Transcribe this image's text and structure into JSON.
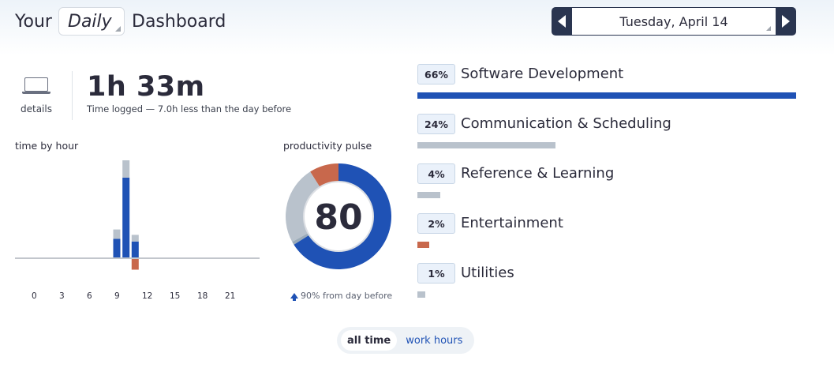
{
  "header": {
    "title_prefix": "Your",
    "period": "Daily",
    "title_suffix": "Dashboard",
    "date": "Tuesday, April 14"
  },
  "summary": {
    "details_label": "details",
    "time_total": "1h 33m",
    "time_note": "Time logged — 7.0h less than the day before"
  },
  "charts": {
    "time_by_hour_title": "time by hour",
    "productivity_title": "productivity pulse",
    "pulse_note": "90% from day before"
  },
  "chart_data": [
    {
      "type": "bar",
      "title": "time by hour",
      "x_ticks": [
        "0",
        "3",
        "6",
        "9",
        "12",
        "15",
        "18",
        "21"
      ],
      "hours": [
        9,
        10,
        11
      ],
      "series": [
        {
          "color": "#1f52b5",
          "values_minutes": [
            14,
            60,
            12
          ],
          "direction": "up"
        },
        {
          "color": "#b9c2cc",
          "values_minutes": [
            7,
            13,
            5
          ],
          "direction": "up"
        },
        {
          "color": "#c8684c",
          "values_minutes": [
            0,
            0,
            8
          ],
          "direction": "down"
        }
      ]
    },
    {
      "type": "pie",
      "title": "productivity pulse",
      "center_value": "80",
      "slices": [
        {
          "color": "#1f52b5",
          "value": 66
        },
        {
          "color": "#9aaab8",
          "value": 1
        },
        {
          "color": "#b9c2cc",
          "value": 24
        },
        {
          "color": "#c8684c",
          "value": 9
        }
      ]
    }
  ],
  "categories": [
    {
      "percent": "66%",
      "name": "Software Development",
      "fraction": 0.66,
      "color": "#1f52b5"
    },
    {
      "percent": "24%",
      "name": "Communication & Scheduling",
      "fraction": 0.24,
      "color": "#b9c2cc"
    },
    {
      "percent": "4%",
      "name": "Reference & Learning",
      "fraction": 0.04,
      "color": "#b9c2cc"
    },
    {
      "percent": "2%",
      "name": "Entertainment",
      "fraction": 0.02,
      "color": "#c8684c"
    },
    {
      "percent": "1%",
      "name": "Utilities",
      "fraction": 0.01,
      "color": "#b9c2cc"
    }
  ],
  "toggle": {
    "all_time": "all time",
    "work_hours": "work hours"
  }
}
